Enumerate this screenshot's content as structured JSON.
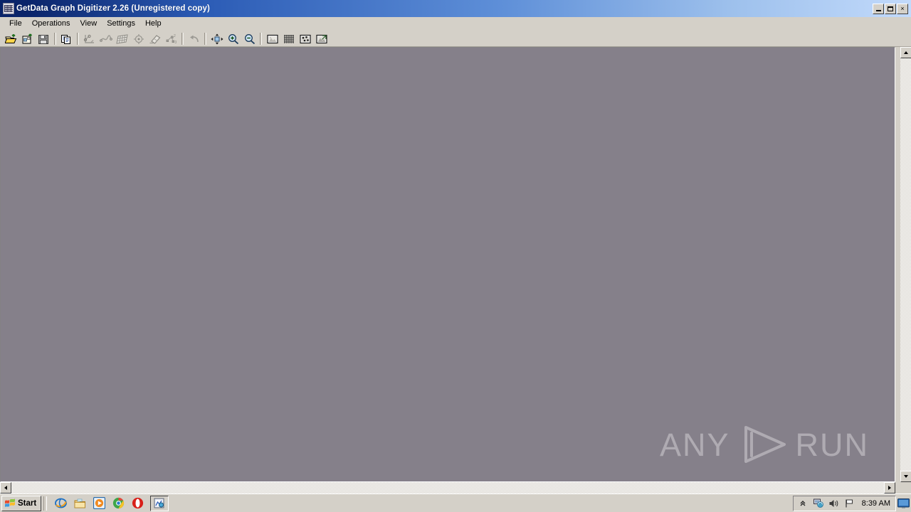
{
  "window": {
    "title": "GetData Graph Digitizer 2.26 (Unregistered copy)",
    "icon": "app-graph-icon",
    "controls": [
      {
        "name": "minimize",
        "label": "_"
      },
      {
        "name": "maximize",
        "label": "□"
      },
      {
        "name": "close",
        "label": "×"
      }
    ]
  },
  "menubar": {
    "items": [
      {
        "label": "File"
      },
      {
        "label": "Operations"
      },
      {
        "label": "View"
      },
      {
        "label": "Settings"
      },
      {
        "label": "Help"
      }
    ]
  },
  "toolbar": {
    "groups": [
      {
        "buttons": [
          {
            "name": "open-image-button",
            "icon": "open-folder-icon",
            "enabled": true
          },
          {
            "name": "open-project-button",
            "icon": "open-project-icon",
            "enabled": true
          },
          {
            "name": "save-button",
            "icon": "floppy-disk-icon",
            "enabled": true
          }
        ]
      },
      {
        "buttons": [
          {
            "name": "copy-button",
            "icon": "copy-icon",
            "enabled": true
          }
        ]
      },
      {
        "buttons": [
          {
            "name": "set-axes-button",
            "icon": "axes-icon",
            "enabled": false
          },
          {
            "name": "curve-button",
            "icon": "curve-icon",
            "enabled": false
          },
          {
            "name": "grid-setup-button",
            "icon": "grid-perspective-icon",
            "enabled": false
          },
          {
            "name": "capture-point-button",
            "icon": "crosshair-target-icon",
            "enabled": false
          },
          {
            "name": "eraser-button",
            "icon": "eraser-icon",
            "enabled": false
          },
          {
            "name": "points-button",
            "icon": "points-number-icon",
            "enabled": false
          }
        ]
      },
      {
        "buttons": [
          {
            "name": "undo-button",
            "icon": "undo-arrow-icon",
            "enabled": false
          }
        ]
      },
      {
        "buttons": [
          {
            "name": "pan-button",
            "icon": "pan-move-icon",
            "enabled": true
          },
          {
            "name": "zoom-in-button",
            "icon": "zoom-in-icon",
            "enabled": true
          },
          {
            "name": "zoom-out-button",
            "icon": "zoom-out-icon",
            "enabled": true
          }
        ]
      },
      {
        "buttons": [
          {
            "name": "show-image-button",
            "icon": "image-thumb-icon",
            "enabled": true
          },
          {
            "name": "show-grid-button",
            "icon": "grid-mesh-icon",
            "enabled": true
          },
          {
            "name": "show-points-button",
            "icon": "scatter-points-icon",
            "enabled": true
          },
          {
            "name": "fit-to-window-button",
            "icon": "fit-image-icon",
            "enabled": true
          }
        ]
      }
    ]
  },
  "canvas": {
    "background_color": "#85808a",
    "watermark": {
      "left_text": "ANY",
      "right_text": "RUN",
      "logo": "play-triangle-icon",
      "color": "#c9c6cb"
    }
  },
  "scrollbars": {
    "vertical": {
      "up": "scroll-up-arrow",
      "down": "scroll-down-arrow"
    },
    "horizontal": {
      "left": "scroll-left-arrow",
      "right": "scroll-right-arrow"
    }
  },
  "taskbar": {
    "start_label": "Start",
    "quick_launch": [
      {
        "name": "internet-explorer-icon",
        "label": "Internet Explorer"
      },
      {
        "name": "explorer-folder-icon",
        "label": "Windows Explorer"
      },
      {
        "name": "media-player-icon",
        "label": "Media Player"
      },
      {
        "name": "chrome-icon",
        "label": "Google Chrome"
      },
      {
        "name": "opera-icon",
        "label": "Opera"
      }
    ],
    "tasks": [
      {
        "name": "taskbar-getdata-button",
        "icon": "app-graph-icon"
      }
    ],
    "tray": {
      "icons": [
        {
          "name": "show-hidden-icons-chevron"
        },
        {
          "name": "network-connection-icon"
        },
        {
          "name": "volume-icon"
        },
        {
          "name": "flag-icon"
        }
      ],
      "clock": "8:39 AM",
      "show_desktop": "show-desktop-icon"
    }
  }
}
